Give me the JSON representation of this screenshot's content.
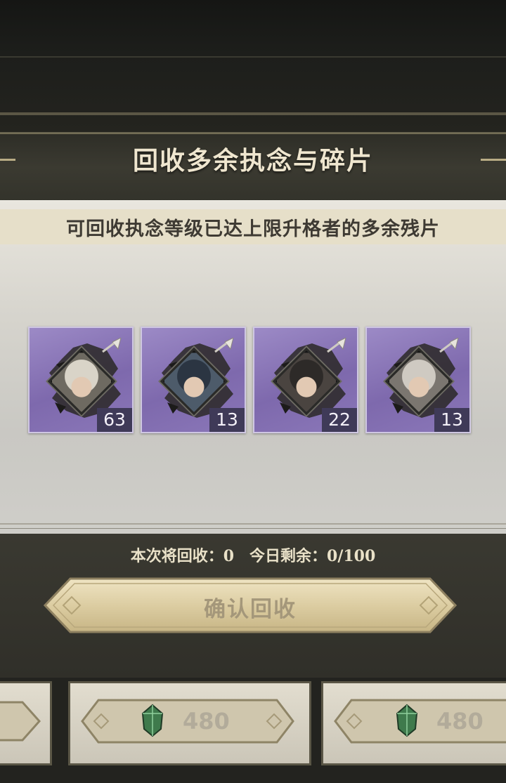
{
  "dialog": {
    "title": "回收多余执念与碎片",
    "subtitle": "可回收执念等级已达上限升格者的多余残片"
  },
  "fragments": [
    {
      "count": "63",
      "portrait_color": "#6e6a61",
      "hair": "#d9d4c8"
    },
    {
      "count": "13",
      "portrait_color": "#4d5b6a",
      "hair": "#2b3542"
    },
    {
      "count": "22",
      "portrait_color": "#4a4440",
      "hair": "#2d2a28"
    },
    {
      "count": "13",
      "portrait_color": "#7b7670",
      "hair": "#cfcac2"
    }
  ],
  "status": {
    "text": "本次将回收：0　今日剩余：0/100"
  },
  "confirm_button": {
    "label": "确认回收"
  },
  "shop": {
    "items": [
      {
        "price": "480",
        "icon": "green-gem-icon"
      },
      {
        "price": "480",
        "icon": "green-gem-icon"
      }
    ]
  },
  "colors": {
    "card_purple": "#8a77b8",
    "badge": "#3f3a58",
    "gold_button": "#d8c9a0"
  }
}
